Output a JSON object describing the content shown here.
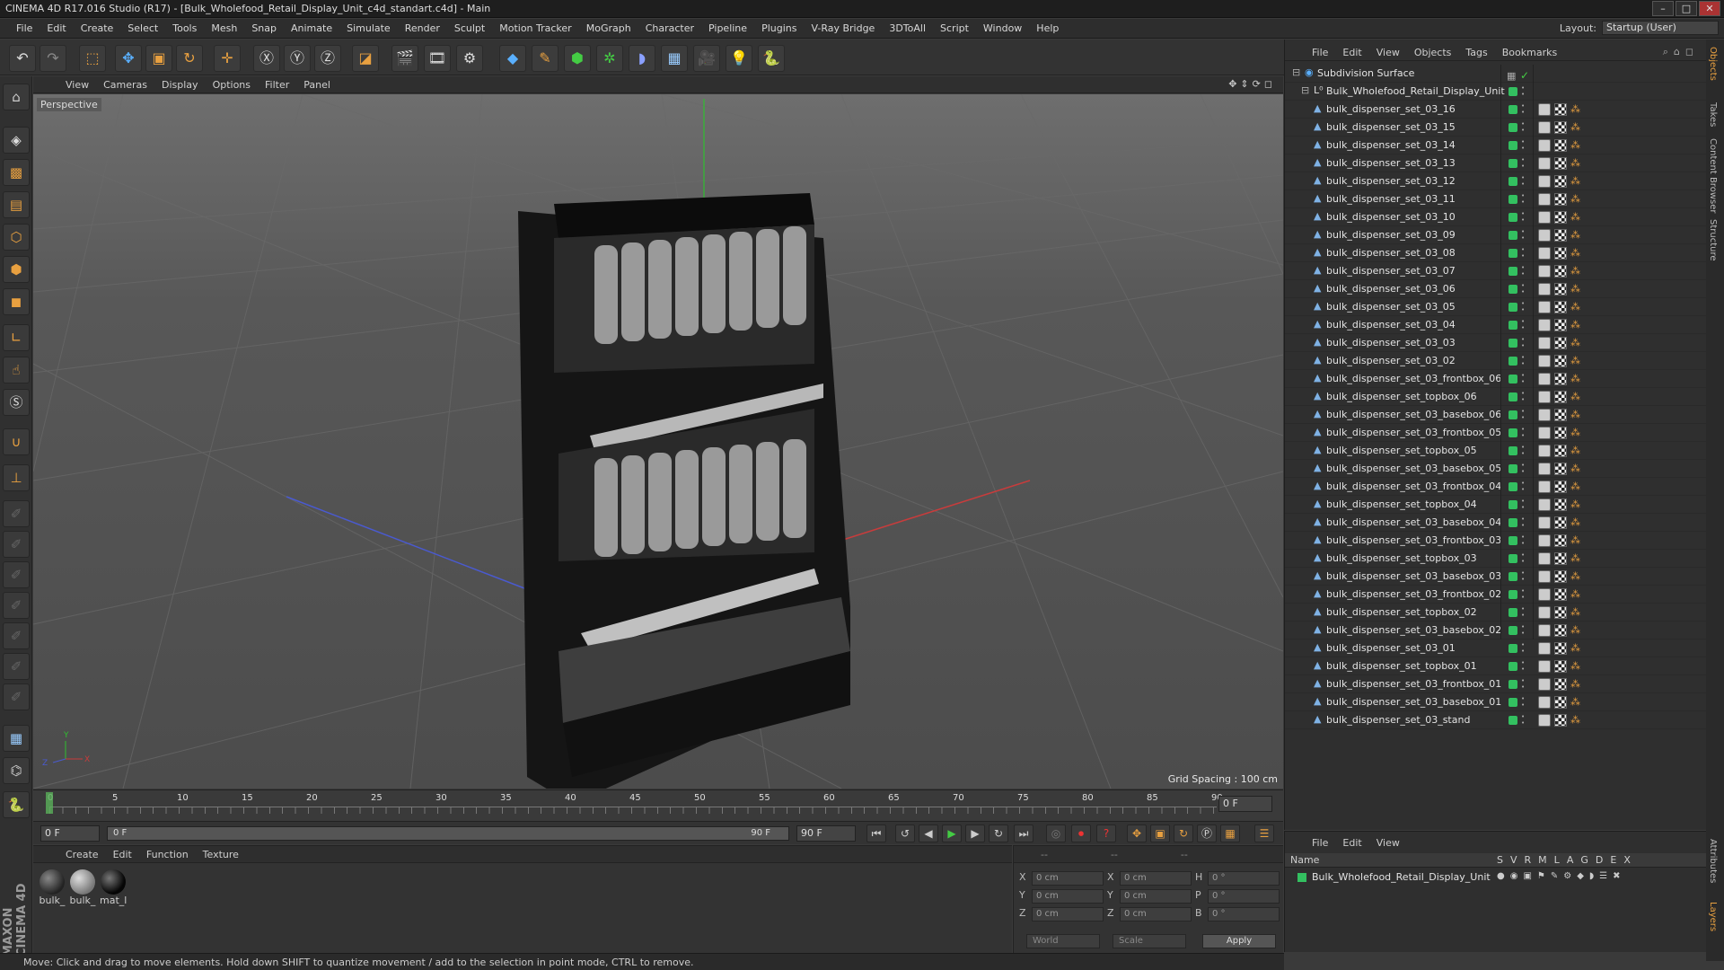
{
  "window": {
    "title": "CINEMA 4D R17.016 Studio (R17) - [Bulk_Wholefood_Retail_Display_Unit_c4d_standart.c4d] - Main"
  },
  "menubar": {
    "items": [
      "File",
      "Edit",
      "Create",
      "Select",
      "Tools",
      "Mesh",
      "Snap",
      "Animate",
      "Simulate",
      "Render",
      "Sculpt",
      "Motion Tracker",
      "MoGraph",
      "Character",
      "Pipeline",
      "Plugins",
      "V-Ray Bridge",
      "3DToAll",
      "Script",
      "Window",
      "Help"
    ],
    "layout_label": "Layout:",
    "layout_value": "Startup (User)"
  },
  "viewport": {
    "menu": [
      "View",
      "Cameras",
      "Display",
      "Options",
      "Filter",
      "Panel"
    ],
    "label": "Perspective",
    "grid_spacing": "Grid Spacing : 100 cm"
  },
  "timeline": {
    "ticks": [
      "0",
      "5",
      "10",
      "15",
      "20",
      "25",
      "30",
      "35",
      "40",
      "45",
      "50",
      "55",
      "60",
      "65",
      "70",
      "75",
      "80",
      "85",
      "90"
    ],
    "current_frame": "0 F",
    "start_field": "0 F",
    "range_start": "0 F",
    "range_end": "90 F",
    "end_field": "90 F"
  },
  "materials": {
    "menu": [
      "Create",
      "Edit",
      "Function",
      "Texture"
    ],
    "items": [
      {
        "label": "bulk_"
      },
      {
        "label": "bulk_"
      },
      {
        "label": "mat_l"
      }
    ]
  },
  "coords": {
    "headers": [
      "--",
      "--",
      "--"
    ],
    "rows": [
      {
        "a": "X",
        "av": "0 cm",
        "b": "X",
        "bv": "0 cm",
        "c": "H",
        "cv": "0 °"
      },
      {
        "a": "Y",
        "av": "0 cm",
        "b": "Y",
        "bv": "0 cm",
        "c": "P",
        "cv": "0 °"
      },
      {
        "a": "Z",
        "av": "0 cm",
        "b": "Z",
        "bv": "0 cm",
        "c": "B",
        "cv": "0 °"
      }
    ],
    "world": "World",
    "scale": "Scale",
    "apply": "Apply"
  },
  "objects": {
    "menu": [
      "File",
      "Edit",
      "View",
      "Objects",
      "Tags",
      "Bookmarks"
    ],
    "root": "Subdivision Surface",
    "group": "Bulk_Wholefood_Retail_Display_Unit",
    "items": [
      "bulk_dispenser_set_03_16",
      "bulk_dispenser_set_03_15",
      "bulk_dispenser_set_03_14",
      "bulk_dispenser_set_03_13",
      "bulk_dispenser_set_03_12",
      "bulk_dispenser_set_03_11",
      "bulk_dispenser_set_03_10",
      "bulk_dispenser_set_03_09",
      "bulk_dispenser_set_03_08",
      "bulk_dispenser_set_03_07",
      "bulk_dispenser_set_03_06",
      "bulk_dispenser_set_03_05",
      "bulk_dispenser_set_03_04",
      "bulk_dispenser_set_03_03",
      "bulk_dispenser_set_03_02",
      "bulk_dispenser_set_03_frontbox_06",
      "bulk_dispenser_set_topbox_06",
      "bulk_dispenser_set_03_basebox_06",
      "bulk_dispenser_set_03_frontbox_05",
      "bulk_dispenser_set_topbox_05",
      "bulk_dispenser_set_03_basebox_05",
      "bulk_dispenser_set_03_frontbox_04",
      "bulk_dispenser_set_topbox_04",
      "bulk_dispenser_set_03_basebox_04",
      "bulk_dispenser_set_03_frontbox_03",
      "bulk_dispenser_set_topbox_03",
      "bulk_dispenser_set_03_basebox_03",
      "bulk_dispenser_set_03_frontbox_02",
      "bulk_dispenser_set_topbox_02",
      "bulk_dispenser_set_03_basebox_02",
      "bulk_dispenser_set_03_01",
      "bulk_dispenser_set_topbox_01",
      "bulk_dispenser_set_03_frontbox_01",
      "bulk_dispenser_set_03_basebox_01",
      "bulk_dispenser_set_03_stand"
    ]
  },
  "layers": {
    "menu": [
      "File",
      "Edit",
      "View"
    ],
    "header_name": "Name",
    "header_cols": [
      "S",
      "V",
      "R",
      "M",
      "L",
      "A",
      "G",
      "D",
      "E",
      "X"
    ],
    "row": "Bulk_Wholefood_Retail_Display_Unit"
  },
  "side_tabs": [
    "Objects",
    "Takes",
    "Content Browser",
    "Structure",
    "Attributes",
    "Layers"
  ],
  "status": "Move: Click and drag to move elements. Hold down SHIFT to quantize movement / add to the selection in point mode, CTRL to remove.",
  "brand": "MAXON CINEMA 4D",
  "colors": {
    "accent": "#e8a040",
    "green": "#33c060",
    "axis_x": "#c83c3c",
    "axis_z": "#4a5ad0"
  }
}
